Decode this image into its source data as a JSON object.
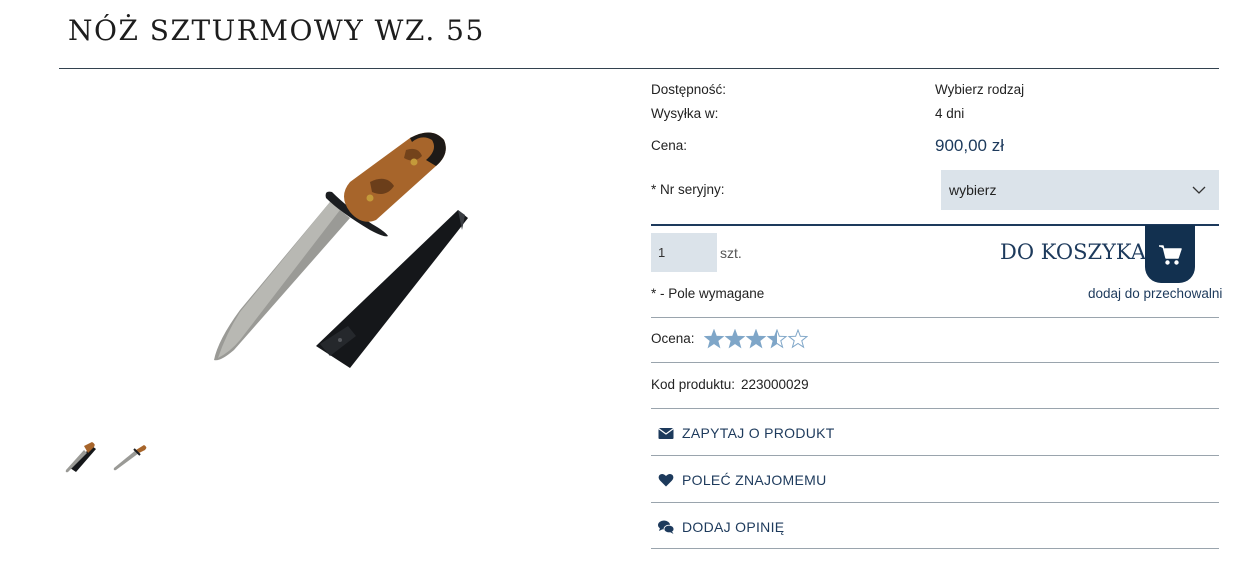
{
  "product": {
    "title": "NÓŻ SZTURMOWY WZ. 55",
    "availability_label": "Dostępność:",
    "availability_value": "Wybierz rodzaj",
    "shipping_label": "Wysyłka w:",
    "shipping_value": "4 dni",
    "price_label": "Cena:",
    "price_value": "900,00 zł",
    "serial_label": "* Nr seryjny:",
    "serial_select_value": "wybierz",
    "quantity_value": "1",
    "quantity_unit": "szt.",
    "add_to_cart_label": "DO KOSZYKA",
    "required_note": "* - Pole wymagane",
    "storage_link": "dodaj do przechowalni",
    "rating_label": "Ocena:",
    "rating_value": 3.5,
    "rating_max": 5,
    "code_label": "Kod produktu:",
    "code_value": "223000029"
  },
  "actions": [
    {
      "label": "ZAPYTAJ O PRODUKT",
      "icon": "envelope-icon"
    },
    {
      "label": "POLEĆ ZNAJOMEMU",
      "icon": "heart-icon"
    },
    {
      "label": "DODAJ OPINIĘ",
      "icon": "chat-bubbles-icon"
    }
  ],
  "colors": {
    "accent": "#1d3a5c",
    "cart_button": "#12304f",
    "field_bg": "#dbe3ea",
    "star_fill": "#7fa6c8"
  }
}
